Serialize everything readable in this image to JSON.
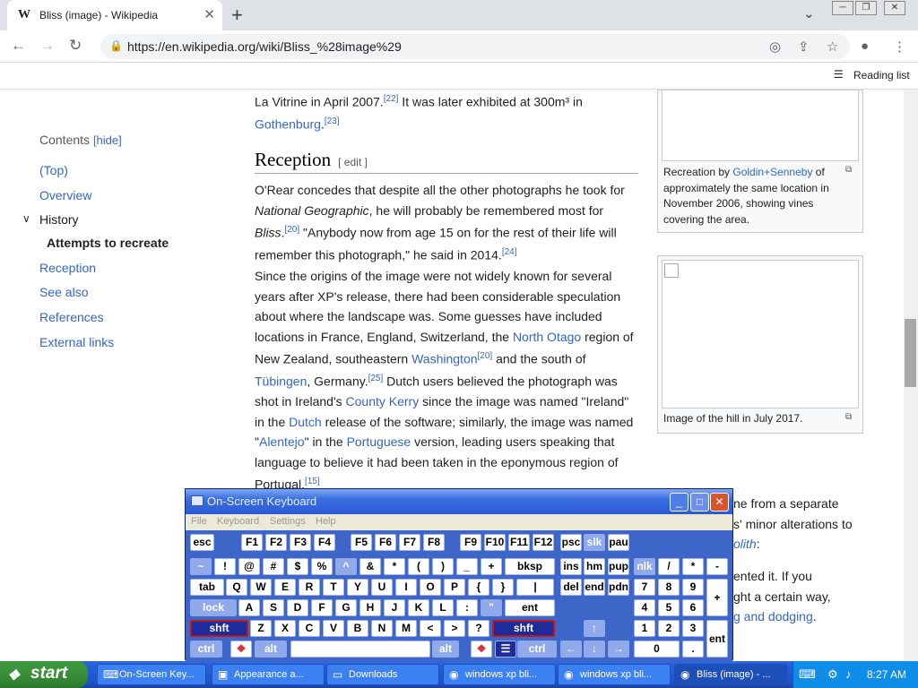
{
  "browser": {
    "tab_title": "Bliss (image) - Wikipedia",
    "tab_favicon": "W",
    "url": "https://en.wikipedia.org/wiki/Bliss_%28image%29",
    "reading_list": "Reading list"
  },
  "toc": {
    "contents": "Contents",
    "hide": "[hide]",
    "items": [
      "(Top)",
      "Overview",
      "History",
      "Attempts to recreate",
      "Reception",
      "See also",
      "References",
      "External links"
    ]
  },
  "article": {
    "p0": {
      "t1": "La Vitrine in April 2007.",
      "s1": "[22]",
      "t2": " It was later exhibited at 300m³ in",
      "l1": "Gothenburg",
      "t3": ".",
      "s2": "[23]"
    },
    "reception": "Reception",
    "edit": "[ edit ]",
    "p1": {
      "a": "O'Rear concedes that despite all the other photographs he took for",
      "b_i": "National Geographic",
      "b": ", he will probably be remembered most for",
      "c_i": "Bliss",
      "c": ".",
      "c_s": "[20]",
      "c2": " \"Anybody now from age 15 on for the rest of their life will",
      "d": "remember this photograph,\" he said in 2014.",
      "d_s": "[24]"
    },
    "p2": {
      "l1": "Since the origins of the image were not widely known for several",
      "l2": "years after XP's release, there had been considerable speculation",
      "l3": "about where the landscape was. Some guesses have included",
      "l4a": "locations in France, England, Switzerland, the ",
      "l4b": "North Otago",
      "l4c": " region of",
      "l5a": "New Zealand, southeastern ",
      "l5b": "Washington",
      "l5s": "[20]",
      "l5c": " and the south of",
      "l6a": "Tübingen",
      "l6b": ", Germany.",
      "l6s": "[25]",
      "l6c": " Dutch users believed the photograph was",
      "l7a": "shot in Ireland's ",
      "l7b": "County Kerry",
      "l7c": " since the image was named \"Ireland\"",
      "l8a": "in the ",
      "l8b": "Dutch",
      "l8c": " release of the software; similarly, the image was named",
      "l9a": "\"",
      "l9b": "Alentejo",
      "l9c": "\" in the ",
      "l9d": "Portuguese",
      "l9e": " version, leading users speaking that",
      "l10": "language to believe it had been taken in the eponymous region of",
      "l11": "Portugal.",
      "l11s": "[15]"
    },
    "cap1": {
      "a": "Recreation by ",
      "b": "Goldin+Senneby",
      "c": " of",
      "d": "approximately the same location in",
      "e": "November 2006, showing vines",
      "f": "covering the area."
    },
    "cap2": "Image of the hill in July 2017.",
    "frag": {
      "f1": "ne from a separate",
      "f2": "s' minor alterations to",
      "f3": "olith",
      "f3b": ":",
      "f4": "ented it. If you",
      "f5": "ght a certain way,",
      "f6": "g and dodging",
      "f6b": "."
    }
  },
  "osk": {
    "title": "On-Screen Keyboard",
    "menu": [
      "File",
      "Keyboard",
      "Settings",
      "Help"
    ],
    "row1": [
      "esc",
      "F1",
      "F2",
      "F3",
      "F4",
      "F5",
      "F6",
      "F7",
      "F8",
      "F9",
      "F10",
      "F11",
      "F12",
      "psc",
      "slk",
      "pau"
    ],
    "row2": [
      "~",
      "!",
      "@",
      "#",
      "$",
      "%",
      "^",
      "&",
      "*",
      "(",
      ")",
      "_",
      "+",
      "bksp",
      "ins",
      "hm",
      "pup",
      "nlk",
      "/",
      "*",
      "-"
    ],
    "row3": [
      "tab",
      "Q",
      "W",
      "E",
      "R",
      "T",
      "Y",
      "U",
      "I",
      "O",
      "P",
      "{",
      "}",
      "|",
      "del",
      "end",
      "pdn",
      "7",
      "8",
      "9",
      "+"
    ],
    "row4": [
      "lock",
      "A",
      "S",
      "D",
      "F",
      "G",
      "H",
      "J",
      "K",
      "L",
      ":",
      "\"",
      "ent",
      "4",
      "5",
      "6"
    ],
    "row5": [
      "shft",
      "Z",
      "X",
      "C",
      "V",
      "B",
      "N",
      "M",
      "<",
      ">",
      "?",
      "shft",
      "↑",
      "1",
      "2",
      "3",
      "ent"
    ],
    "row6": [
      "ctrl",
      "alt",
      "alt",
      "ctrl",
      "←",
      "↓",
      "→",
      "0",
      "."
    ]
  },
  "taskbar": {
    "start": "start",
    "items": [
      "On-Screen Key...",
      "Appearance a...",
      "Downloads",
      "windows xp bli...",
      "windows xp bli...",
      "Bliss (image) - ..."
    ],
    "clock": "8:27 AM"
  }
}
